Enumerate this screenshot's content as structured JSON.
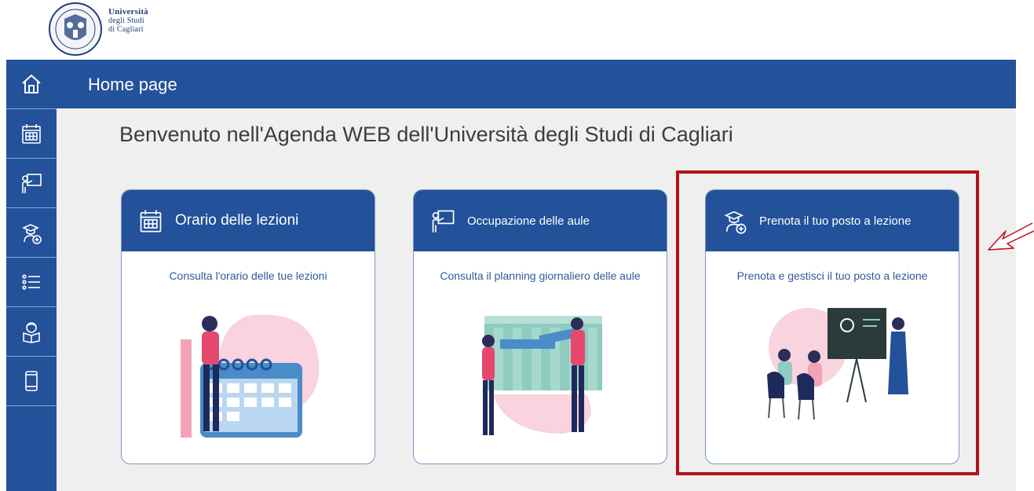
{
  "logo": {
    "line1": "Università",
    "line2": "degli Studi",
    "line3": "di Cagliari"
  },
  "header": {
    "title": "Home page"
  },
  "sidebar": {
    "items": [
      {
        "icon": "home-icon"
      },
      {
        "icon": "calendar-icon"
      },
      {
        "icon": "teacher-board-icon"
      },
      {
        "icon": "student-add-icon"
      },
      {
        "icon": "list-icon"
      },
      {
        "icon": "reader-icon"
      },
      {
        "icon": "mobile-phone-icon"
      }
    ]
  },
  "main": {
    "welcome": "Benvenuto nell'Agenda WEB dell'Università degli Studi di Cagliari",
    "cards": [
      {
        "title": "Orario delle lezioni",
        "description": "Consulta l'orario delle tue lezioni",
        "icon": "calendar-icon"
      },
      {
        "title": "Occupazione delle aule",
        "description": "Consulta il planning giornaliero delle aule",
        "icon": "teacher-board-icon"
      },
      {
        "title": "Prenota il tuo posto a lezione",
        "description": "Prenota e gestisci il tuo posto a lezione",
        "icon": "student-add-icon"
      }
    ]
  },
  "colors": {
    "brand_blue": "#23519a",
    "highlight_red": "#b5121b",
    "background": "#efefef"
  }
}
